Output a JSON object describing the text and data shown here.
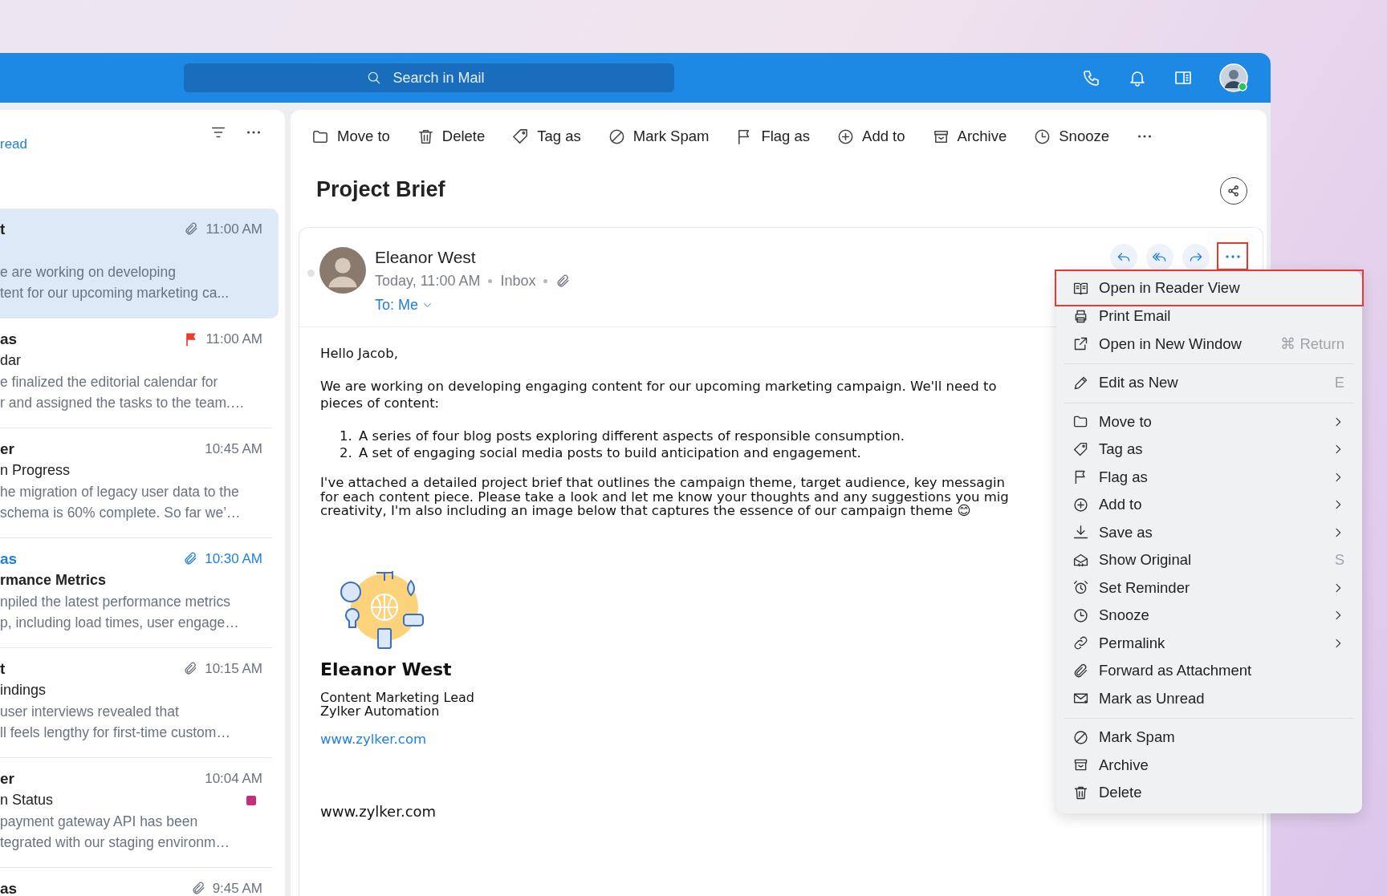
{
  "header": {
    "search": {
      "placeholder": "Search in Mail"
    },
    "user_online": true
  },
  "mail_list": {
    "filter_link": "read",
    "items": [
      {
        "sender": "t",
        "time": "11:00 AM",
        "preview": [
          "e are working on developing",
          "tent for our upcoming marketing ca..."
        ],
        "selected": true,
        "unread": false,
        "flagged": false,
        "attachment": true
      },
      {
        "sender": "as",
        "time": "11:00 AM",
        "subject": "dar",
        "preview": [
          "e finalized the editorial calendar for",
          "r and assigned the tasks to the team.…"
        ],
        "selected": false,
        "unread": false,
        "flagged": true,
        "attachment": false
      },
      {
        "sender": "er",
        "time": "10:45 AM",
        "subject": "n Progress",
        "preview": [
          "he migration of legacy user data to the",
          "schema is 60% complete. So far we’…"
        ],
        "selected": false,
        "unread": false,
        "flagged": false,
        "attachment": false
      },
      {
        "sender": "as",
        "time": "10:30 AM",
        "subject": "rmance Metrics",
        "preview": [
          "npiled the latest performance metrics",
          "p, including load times, user engage…"
        ],
        "selected": false,
        "unread": true,
        "flagged": false,
        "attachment": true
      },
      {
        "sender": "t",
        "time": "10:15 AM",
        "subject": "indings",
        "preview": [
          "user interviews revealed that",
          "ll feels lengthy for first-time custom…"
        ],
        "selected": false,
        "unread": false,
        "flagged": false,
        "attachment": true
      },
      {
        "sender": "er",
        "time": "10:04 AM",
        "subject": "n Status",
        "preview": [
          "payment gateway API has been",
          "tegrated with our staging environm…"
        ],
        "selected": false,
        "unread": false,
        "flagged": false,
        "attachment": false,
        "color": "#c2307a"
      },
      {
        "sender": "as",
        "time": "9:45 AM",
        "selected": false,
        "unread": false,
        "flagged": false,
        "attachment": true
      }
    ]
  },
  "toolbar": [
    "Move to",
    "Delete",
    "Tag as",
    "Mark Spam",
    "Flag as",
    "Add to",
    "Archive",
    "Snooze"
  ],
  "email": {
    "subject": "Project Brief",
    "from": "Eleanor West",
    "date": "Today, 11:00 AM",
    "folder": "Inbox",
    "to": "To: Me",
    "actions": [
      {
        "highlighted": false
      },
      {
        "highlighted": false
      },
      {
        "highlighted": false
      },
      {
        "highlighted": true
      }
    ],
    "greeting": "Hello Jacob,",
    "paragraph_1": [
      "We are working on developing engaging content for our upcoming marketing campaign. We'll need to",
      "pieces of content:"
    ],
    "list": [
      {
        "marker": "1.",
        "text": "A series of four blog posts exploring different aspects of responsible consumption."
      },
      {
        "marker": "2.",
        "text": "A set of engaging social media posts to build anticipation and engagement."
      }
    ],
    "paragraph_2": [
      "I've attached a detailed project brief that outlines the campaign theme, target audience, key messagin",
      "for each content piece. Please take a look and let me know your thoughts and any suggestions you mig",
      "creativity, I'm also including an image below that captures the essence of our campaign theme 😊"
    ],
    "signature": {
      "name": "Eleanor West",
      "title": "Content Marketing Lead",
      "company": "Zylker Automation",
      "link": "www.zylker.com"
    },
    "footer_text": "www.zylker.com"
  },
  "menu": {
    "groups": [
      [
        {
          "label": "Open in Reader View",
          "highlighted": true,
          "submenu": false
        },
        {
          "label": "Print Email",
          "highlighted": false,
          "submenu": false
        },
        {
          "label": "Open in New Window",
          "shortcut": "⌘ Return",
          "highlighted": false,
          "submenu": false
        }
      ],
      [
        {
          "label": "Edit as New",
          "shortcut": "E",
          "highlighted": false,
          "submenu": false
        }
      ],
      [
        {
          "label": "Move to",
          "highlighted": false,
          "submenu": true
        },
        {
          "label": "Tag as",
          "highlighted": false,
          "submenu": true
        },
        {
          "label": "Flag as",
          "highlighted": false,
          "submenu": true
        },
        {
          "label": "Add to",
          "highlighted": false,
          "submenu": true
        },
        {
          "label": "Save as",
          "highlighted": false,
          "submenu": true
        },
        {
          "label": "Show Original",
          "shortcut": "S",
          "highlighted": false,
          "submenu": false
        },
        {
          "label": "Set Reminder",
          "highlighted": false,
          "submenu": true
        },
        {
          "label": "Snooze",
          "highlighted": false,
          "submenu": true
        },
        {
          "label": "Permalink",
          "highlighted": false,
          "submenu": true
        },
        {
          "label": "Forward as Attachment",
          "highlighted": false,
          "submenu": false
        },
        {
          "label": "Mark as Unread",
          "highlighted": false,
          "submenu": false
        }
      ],
      [
        {
          "label": "Mark Spam",
          "highlighted": false,
          "submenu": false
        },
        {
          "label": "Archive",
          "highlighted": false,
          "submenu": false
        },
        {
          "label": "Delete",
          "highlighted": false,
          "submenu": false
        }
      ]
    ]
  }
}
